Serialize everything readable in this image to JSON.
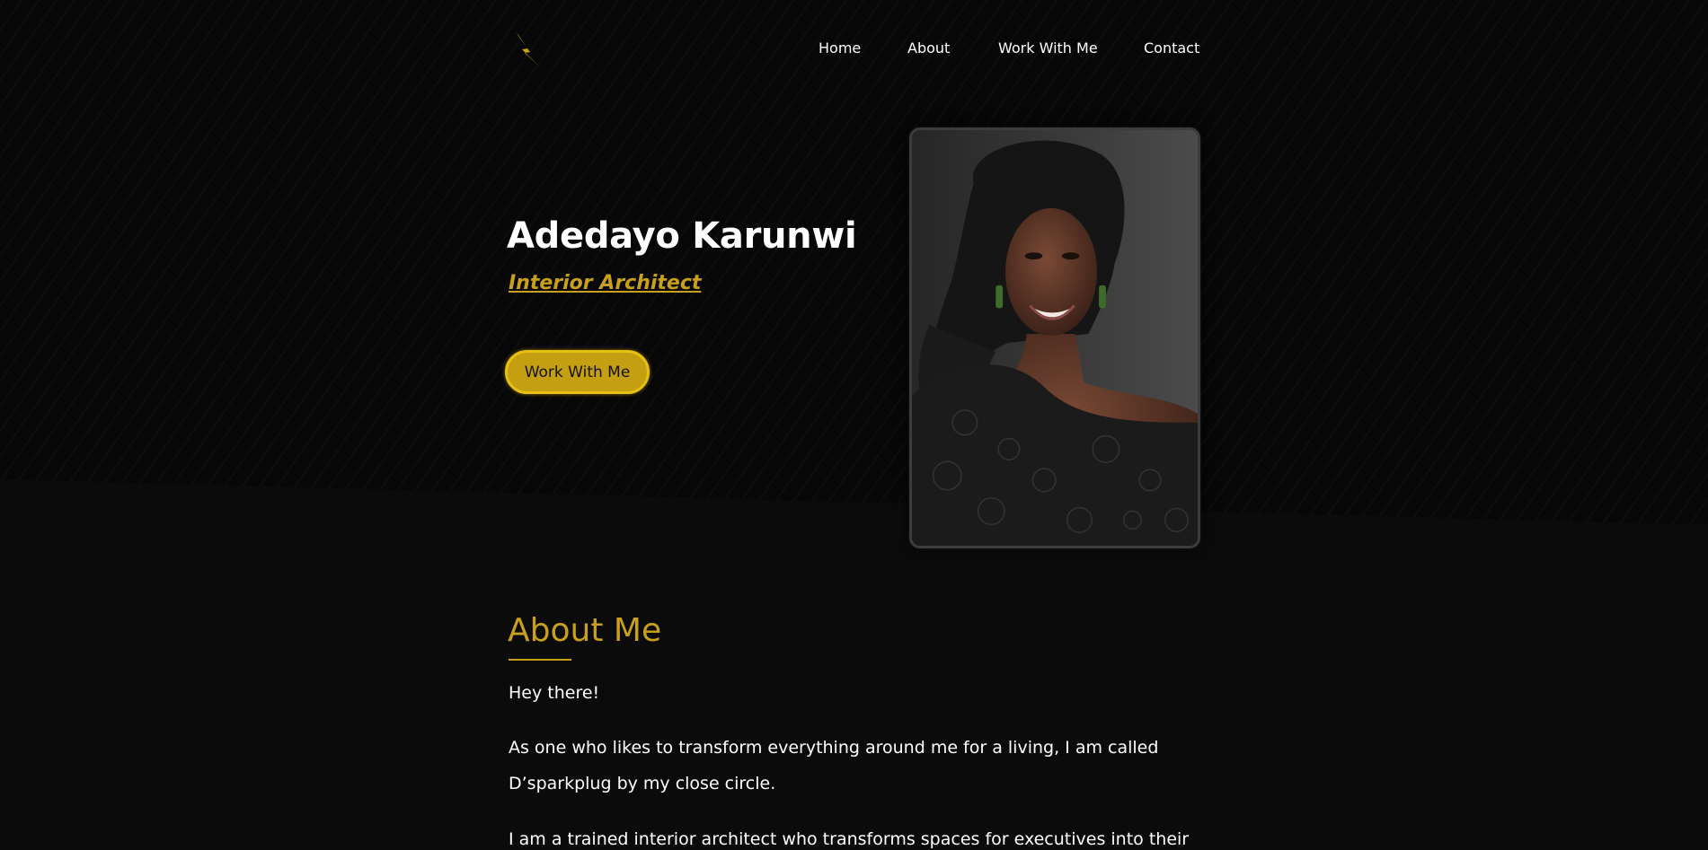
{
  "nav": {
    "logo_icon": "lightning-bolt-icon",
    "items": [
      {
        "label": "Home"
      },
      {
        "label": "About"
      },
      {
        "label": "Work With Me"
      },
      {
        "label": "Contact"
      }
    ]
  },
  "hero": {
    "name": "Adedayo Karunwi",
    "title": "Interior Architect",
    "cta_label": "Work With Me",
    "portrait_icon": "portrait-photo"
  },
  "about": {
    "heading": "About Me",
    "paragraphs": [
      "Hey there!",
      "As one who likes to transform everything around me for a living, I am called D’sparkplug by my close circle.",
      "I am a trained interior architect who transforms spaces for executives into their"
    ]
  },
  "colors": {
    "accent": "#c9a019",
    "button": "#c59f12",
    "background": "#0b0b0b"
  }
}
